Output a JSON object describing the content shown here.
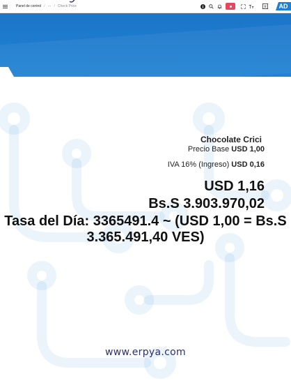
{
  "topbar": {
    "breadcrumb_home": "Panel de control",
    "breadcrumb_more": "···",
    "breadcrumb_current": "Check Price",
    "ad_badge": "AD"
  },
  "price_card": {
    "product_name": "Chocolate Crici",
    "base_label": "Precio Base",
    "base_value": "USD 1,00",
    "tax_label": "IVA 16% (Ingreso)",
    "tax_value": "USD 0,16",
    "total_usd": "USD 1,16",
    "total_ves": "Bs.S 3.903.970,02",
    "rate_line": "Tasa del Día: 3365491.4 ~ (USD 1,00 = Bs.S 3.365.491,40 VES)"
  },
  "footer": {
    "url": "www.erpya.com"
  },
  "colors": {
    "band": "#1f82d3",
    "watermark": "#1f82d3",
    "record": "#e8455f",
    "ad": "#1a82d6"
  }
}
